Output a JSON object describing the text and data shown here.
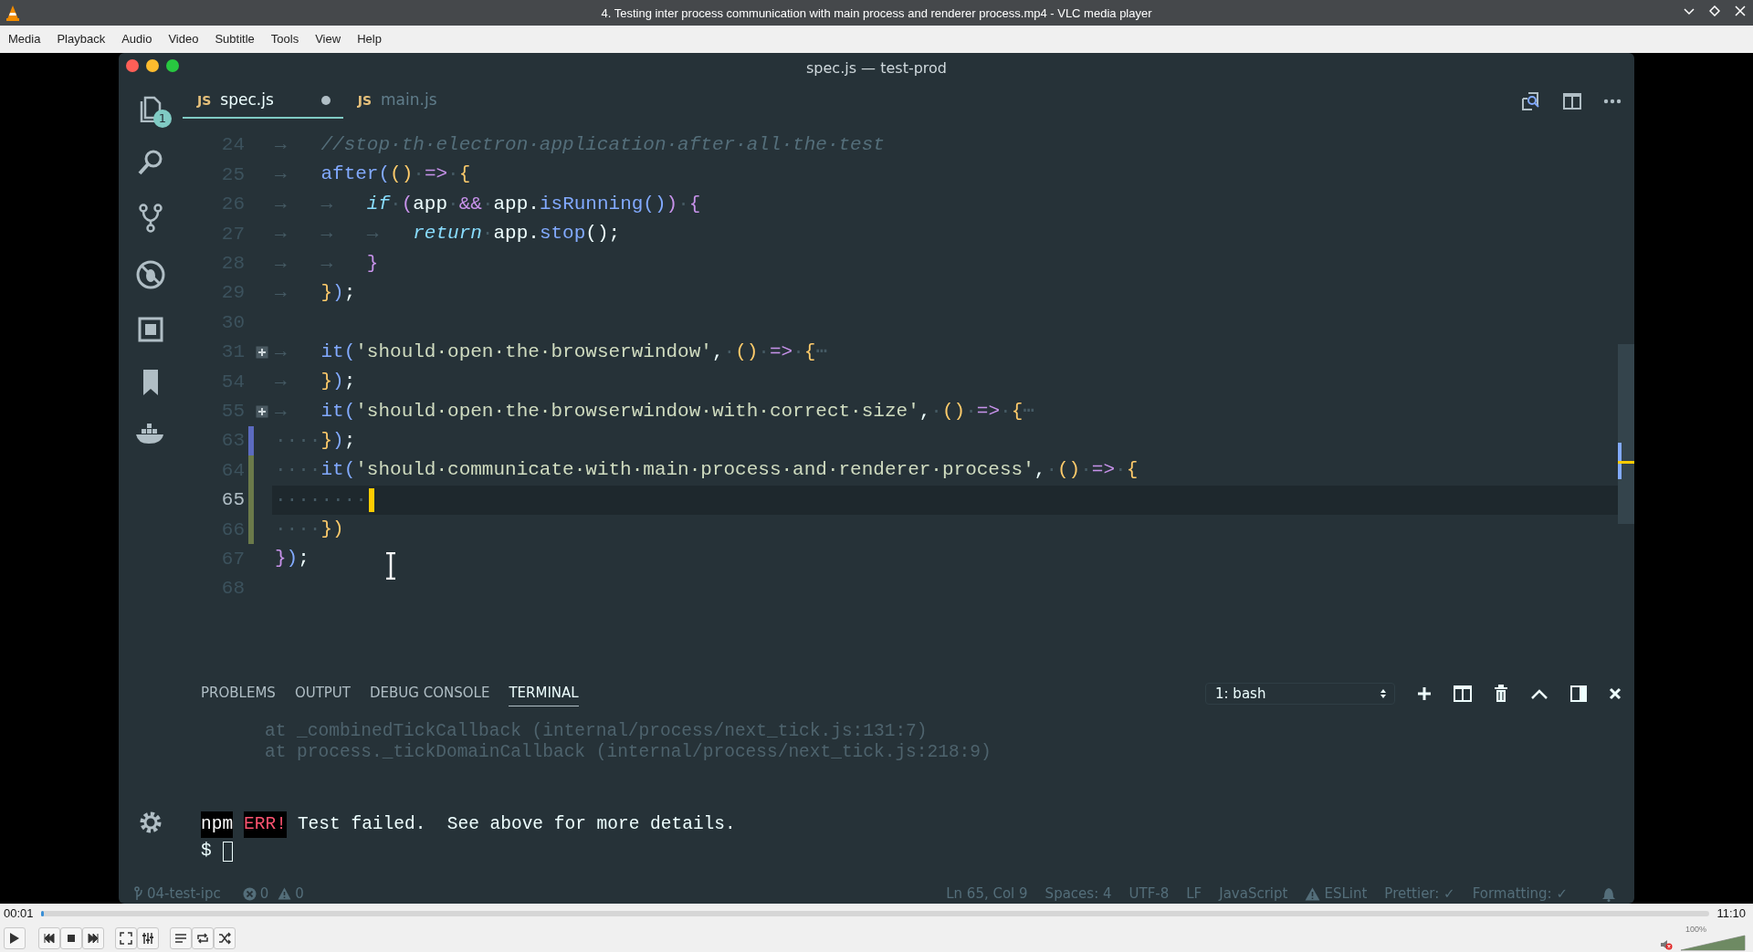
{
  "player": {
    "title": "4. Testing inter process communication with main process and renderer process.mp4 - VLC media player",
    "menu": [
      "Media",
      "Playback",
      "Audio",
      "Video",
      "Subtitle",
      "Tools",
      "View",
      "Help"
    ],
    "elapsed": "00:01",
    "total": "11:10",
    "level": 0.0015,
    "playing": false,
    "muted": true,
    "volume": {
      "level": 1.0,
      "reading": "100%"
    }
  },
  "editor": {
    "title": "spec.js — test-prod",
    "explorer_badge": "1",
    "tabs": [
      {
        "icon_text": "JS",
        "label": "spec.js",
        "selected": true,
        "dirty": true
      },
      {
        "icon_text": "JS",
        "label": "main.js",
        "selected": false,
        "dirty": false
      }
    ],
    "code_lines": [
      {
        "number": "24",
        "current": false,
        "folded": false,
        "tokens": [
          {
            "t": "→   ",
            "kind": "ws"
          },
          {
            "t": "//stop·th·electron·application·after·all·the·test",
            "kind": "comment"
          }
        ]
      },
      {
        "number": "25",
        "current": false,
        "folded": false,
        "tokens": [
          {
            "t": "→   ",
            "kind": "ws"
          },
          {
            "t": "after(",
            "kind": "fn"
          },
          {
            "t": "()",
            "kind": "paren"
          },
          {
            "t": "·",
            "kind": "ws"
          },
          {
            "t": "=>",
            "kind": "op"
          },
          {
            "t": "·",
            "kind": "ws"
          },
          {
            "t": "{",
            "kind": "paren"
          }
        ]
      },
      {
        "number": "26",
        "current": false,
        "folded": false,
        "tokens": [
          {
            "t": "→   →   ",
            "kind": "ws"
          },
          {
            "t": "if",
            "kind": "kw"
          },
          {
            "t": "·",
            "kind": "ws"
          },
          {
            "t": "(",
            "kind": "brace"
          },
          {
            "t": "app",
            "kind": "ident"
          },
          {
            "t": "·",
            "kind": "ws"
          },
          {
            "t": "&&",
            "kind": "op"
          },
          {
            "t": "·",
            "kind": "ws"
          },
          {
            "t": "app.",
            "kind": "ident"
          },
          {
            "t": "isRunning()",
            "kind": "fn"
          },
          {
            "t": ")",
            "kind": "brace"
          },
          {
            "t": "·",
            "kind": "ws"
          },
          {
            "t": "{",
            "kind": "brace"
          }
        ]
      },
      {
        "number": "27",
        "current": false,
        "folded": false,
        "tokens": [
          {
            "t": "→   →   →   ",
            "kind": "ws"
          },
          {
            "t": "return",
            "kind": "kw"
          },
          {
            "t": "·",
            "kind": "ws"
          },
          {
            "t": "app.",
            "kind": "ident"
          },
          {
            "t": "stop",
            "kind": "fn"
          },
          {
            "t": "();",
            "kind": "ident"
          }
        ]
      },
      {
        "number": "28",
        "current": false,
        "folded": false,
        "tokens": [
          {
            "t": "→   →   ",
            "kind": "ws"
          },
          {
            "t": "}",
            "kind": "brace"
          }
        ]
      },
      {
        "number": "29",
        "current": false,
        "folded": false,
        "tokens": [
          {
            "t": "→   ",
            "kind": "ws"
          },
          {
            "t": "}",
            "kind": "paren"
          },
          {
            "t": ")",
            "kind": "fn"
          },
          {
            "t": ";",
            "kind": "ident"
          }
        ]
      },
      {
        "number": "30",
        "current": false,
        "folded": false
      },
      {
        "number": "31",
        "current": false,
        "folded": true,
        "tokens": [
          {
            "t": "→   ",
            "kind": "ws"
          },
          {
            "t": "it(",
            "kind": "fn"
          },
          {
            "t": "'should·open·the·browserwindow'",
            "kind": "str"
          },
          {
            "t": ",",
            "kind": "ident"
          },
          {
            "t": "·",
            "kind": "ws"
          },
          {
            "t": "()",
            "kind": "paren"
          },
          {
            "t": "·",
            "kind": "ws"
          },
          {
            "t": "=>",
            "kind": "op"
          },
          {
            "t": "·",
            "kind": "ws"
          },
          {
            "t": "{",
            "kind": "paren"
          },
          {
            "t": "⋯",
            "kind": "ws"
          }
        ]
      },
      {
        "number": "54",
        "current": false,
        "folded": false,
        "tokens": [
          {
            "t": "→   ",
            "kind": "ws"
          },
          {
            "t": "}",
            "kind": "paren"
          },
          {
            "t": ")",
            "kind": "fn"
          },
          {
            "t": ";",
            "kind": "ident"
          }
        ]
      },
      {
        "number": "55",
        "current": false,
        "folded": true,
        "tokens": [
          {
            "t": "→   ",
            "kind": "ws"
          },
          {
            "t": "it(",
            "kind": "fn"
          },
          {
            "t": "'should·open·the·browserwindow·with·correct·size'",
            "kind": "str"
          },
          {
            "t": ",",
            "kind": "ident"
          },
          {
            "t": "·",
            "kind": "ws"
          },
          {
            "t": "()",
            "kind": "paren"
          },
          {
            "t": "·",
            "kind": "ws"
          },
          {
            "t": "=>",
            "kind": "op"
          },
          {
            "t": "·",
            "kind": "ws"
          },
          {
            "t": "{",
            "kind": "paren"
          },
          {
            "t": "⋯",
            "kind": "ws"
          }
        ]
      },
      {
        "number": "63",
        "current": false,
        "folded": false,
        "color": "#5c6bc0",
        "tokens": [
          {
            "t": "····",
            "kind": "ws"
          },
          {
            "t": "}",
            "kind": "paren"
          },
          {
            "t": ")",
            "kind": "fn"
          },
          {
            "t": ";",
            "kind": "ident"
          }
        ]
      },
      {
        "number": "64",
        "current": false,
        "folded": false,
        "color": "#6b7a4a",
        "tokens": [
          {
            "t": "····",
            "kind": "ws"
          },
          {
            "t": "it(",
            "kind": "fn"
          },
          {
            "t": "'should·communicate·with·main·process·and·renderer·process'",
            "kind": "str"
          },
          {
            "t": ",",
            "kind": "ident"
          },
          {
            "t": "·",
            "kind": "ws"
          },
          {
            "t": "()",
            "kind": "paren"
          },
          {
            "t": "·",
            "kind": "ws"
          },
          {
            "t": "=>",
            "kind": "op"
          },
          {
            "t": "·",
            "kind": "ws"
          },
          {
            "t": "{",
            "kind": "paren"
          }
        ]
      },
      {
        "number": "65",
        "current": true,
        "folded": false,
        "color": "#6b7a4a",
        "tokens": [
          {
            "t": "········",
            "kind": "ws"
          }
        ]
      },
      {
        "number": "66",
        "current": false,
        "folded": false,
        "color": "#6b7a4a",
        "tokens": [
          {
            "t": "····",
            "kind": "ws"
          },
          {
            "t": "})",
            "kind": "paren"
          }
        ]
      },
      {
        "number": "67",
        "current": false,
        "folded": false,
        "tokens": [
          {
            "t": "}",
            "kind": "brace"
          },
          {
            "t": ")",
            "kind": "fn"
          },
          {
            "t": ";",
            "kind": "ident"
          }
        ]
      },
      {
        "number": "68",
        "current": false,
        "folded": false
      }
    ],
    "panel": {
      "tabs": [
        {
          "label": "PROBLEMS",
          "selected": false
        },
        {
          "label": "OUTPUT",
          "selected": false
        },
        {
          "label": "DEBUG CONSOLE",
          "selected": false
        },
        {
          "label": "TERMINAL",
          "selected": true
        }
      ],
      "terminal_select": "1: bash",
      "trace": [
        "at _combinedTickCallback (internal/process/next_tick.js:131:7)",
        "at process._tickDomainCallback (internal/process/next_tick.js:218:9)"
      ],
      "error": {
        "tool": "npm",
        "level": "ERR!",
        "message": "Test failed.  See above for more details."
      },
      "prompt": "$"
    },
    "status_bar": {
      "branch": "04-test-ipc",
      "errors": "0",
      "warnings": "0",
      "items": [
        {
          "text": "Ln 65, Col 9",
          "kind": "plain"
        },
        {
          "text": "Spaces: 4",
          "kind": "plain"
        },
        {
          "text": "UTF-8",
          "kind": "plain"
        },
        {
          "text": "LF",
          "kind": "plain"
        },
        {
          "text": "JavaScript",
          "kind": "plain"
        },
        {
          "text": "ESLint",
          "kind": "warning"
        },
        {
          "text": "Prettier: ✓",
          "kind": "plain"
        },
        {
          "text": "Formatting: ✓",
          "kind": "plain"
        }
      ]
    }
  }
}
